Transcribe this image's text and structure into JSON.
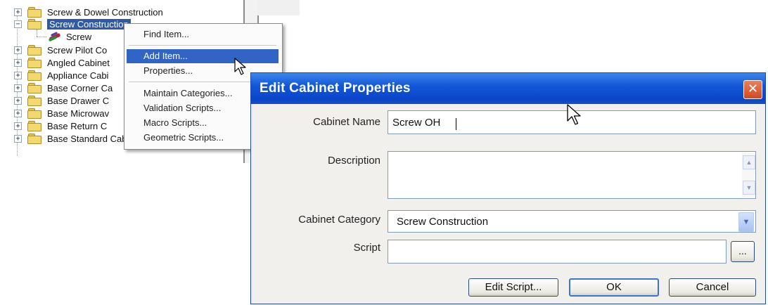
{
  "tree": {
    "items": [
      {
        "label": "Screw & Dowel Construction",
        "expander": "+"
      },
      {
        "label": "Screw Construction",
        "expander": "−",
        "selected": true
      },
      {
        "label": "Screw",
        "child": true
      },
      {
        "label": "Screw Pilot Co",
        "expander": "+"
      },
      {
        "label": "Angled Cabinet",
        "expander": "+"
      },
      {
        "label": "Appliance Cabi",
        "expander": "+"
      },
      {
        "label": "Base Corner Ca",
        "expander": "+"
      },
      {
        "label": "Base Drawer C",
        "expander": "+"
      },
      {
        "label": "Base Microwav",
        "expander": "+"
      },
      {
        "label": "Base Return C",
        "expander": "+"
      },
      {
        "label": "Base Standard Cabinets",
        "expander": "+"
      }
    ]
  },
  "context_menu": {
    "items": [
      {
        "label": "Find Item..."
      },
      {
        "label": "Add Item...",
        "highlighted": true
      },
      {
        "label": "Properties..."
      },
      {
        "label": "Maintain Categories..."
      },
      {
        "label": "Validation Scripts..."
      },
      {
        "label": "Macro Scripts..."
      },
      {
        "label": "Geometric Scripts..."
      }
    ]
  },
  "dialog": {
    "title": "Edit Cabinet Properties",
    "close_glyph": "✕",
    "fields": {
      "cabinet_name": {
        "label": "Cabinet Name",
        "value": "Screw OH"
      },
      "description": {
        "label": "Description",
        "value": ""
      },
      "cabinet_category": {
        "label": "Cabinet Category",
        "value": "Screw Construction"
      },
      "script": {
        "label": "Script",
        "value": ""
      }
    },
    "browse_label": "...",
    "buttons": {
      "edit_script": "Edit Script...",
      "ok": "OK",
      "cancel": "Cancel"
    }
  },
  "colors": {
    "titlebar": "#0a45c8",
    "menu_highlight": "#3164c4",
    "selection": "#2f5aa8"
  }
}
